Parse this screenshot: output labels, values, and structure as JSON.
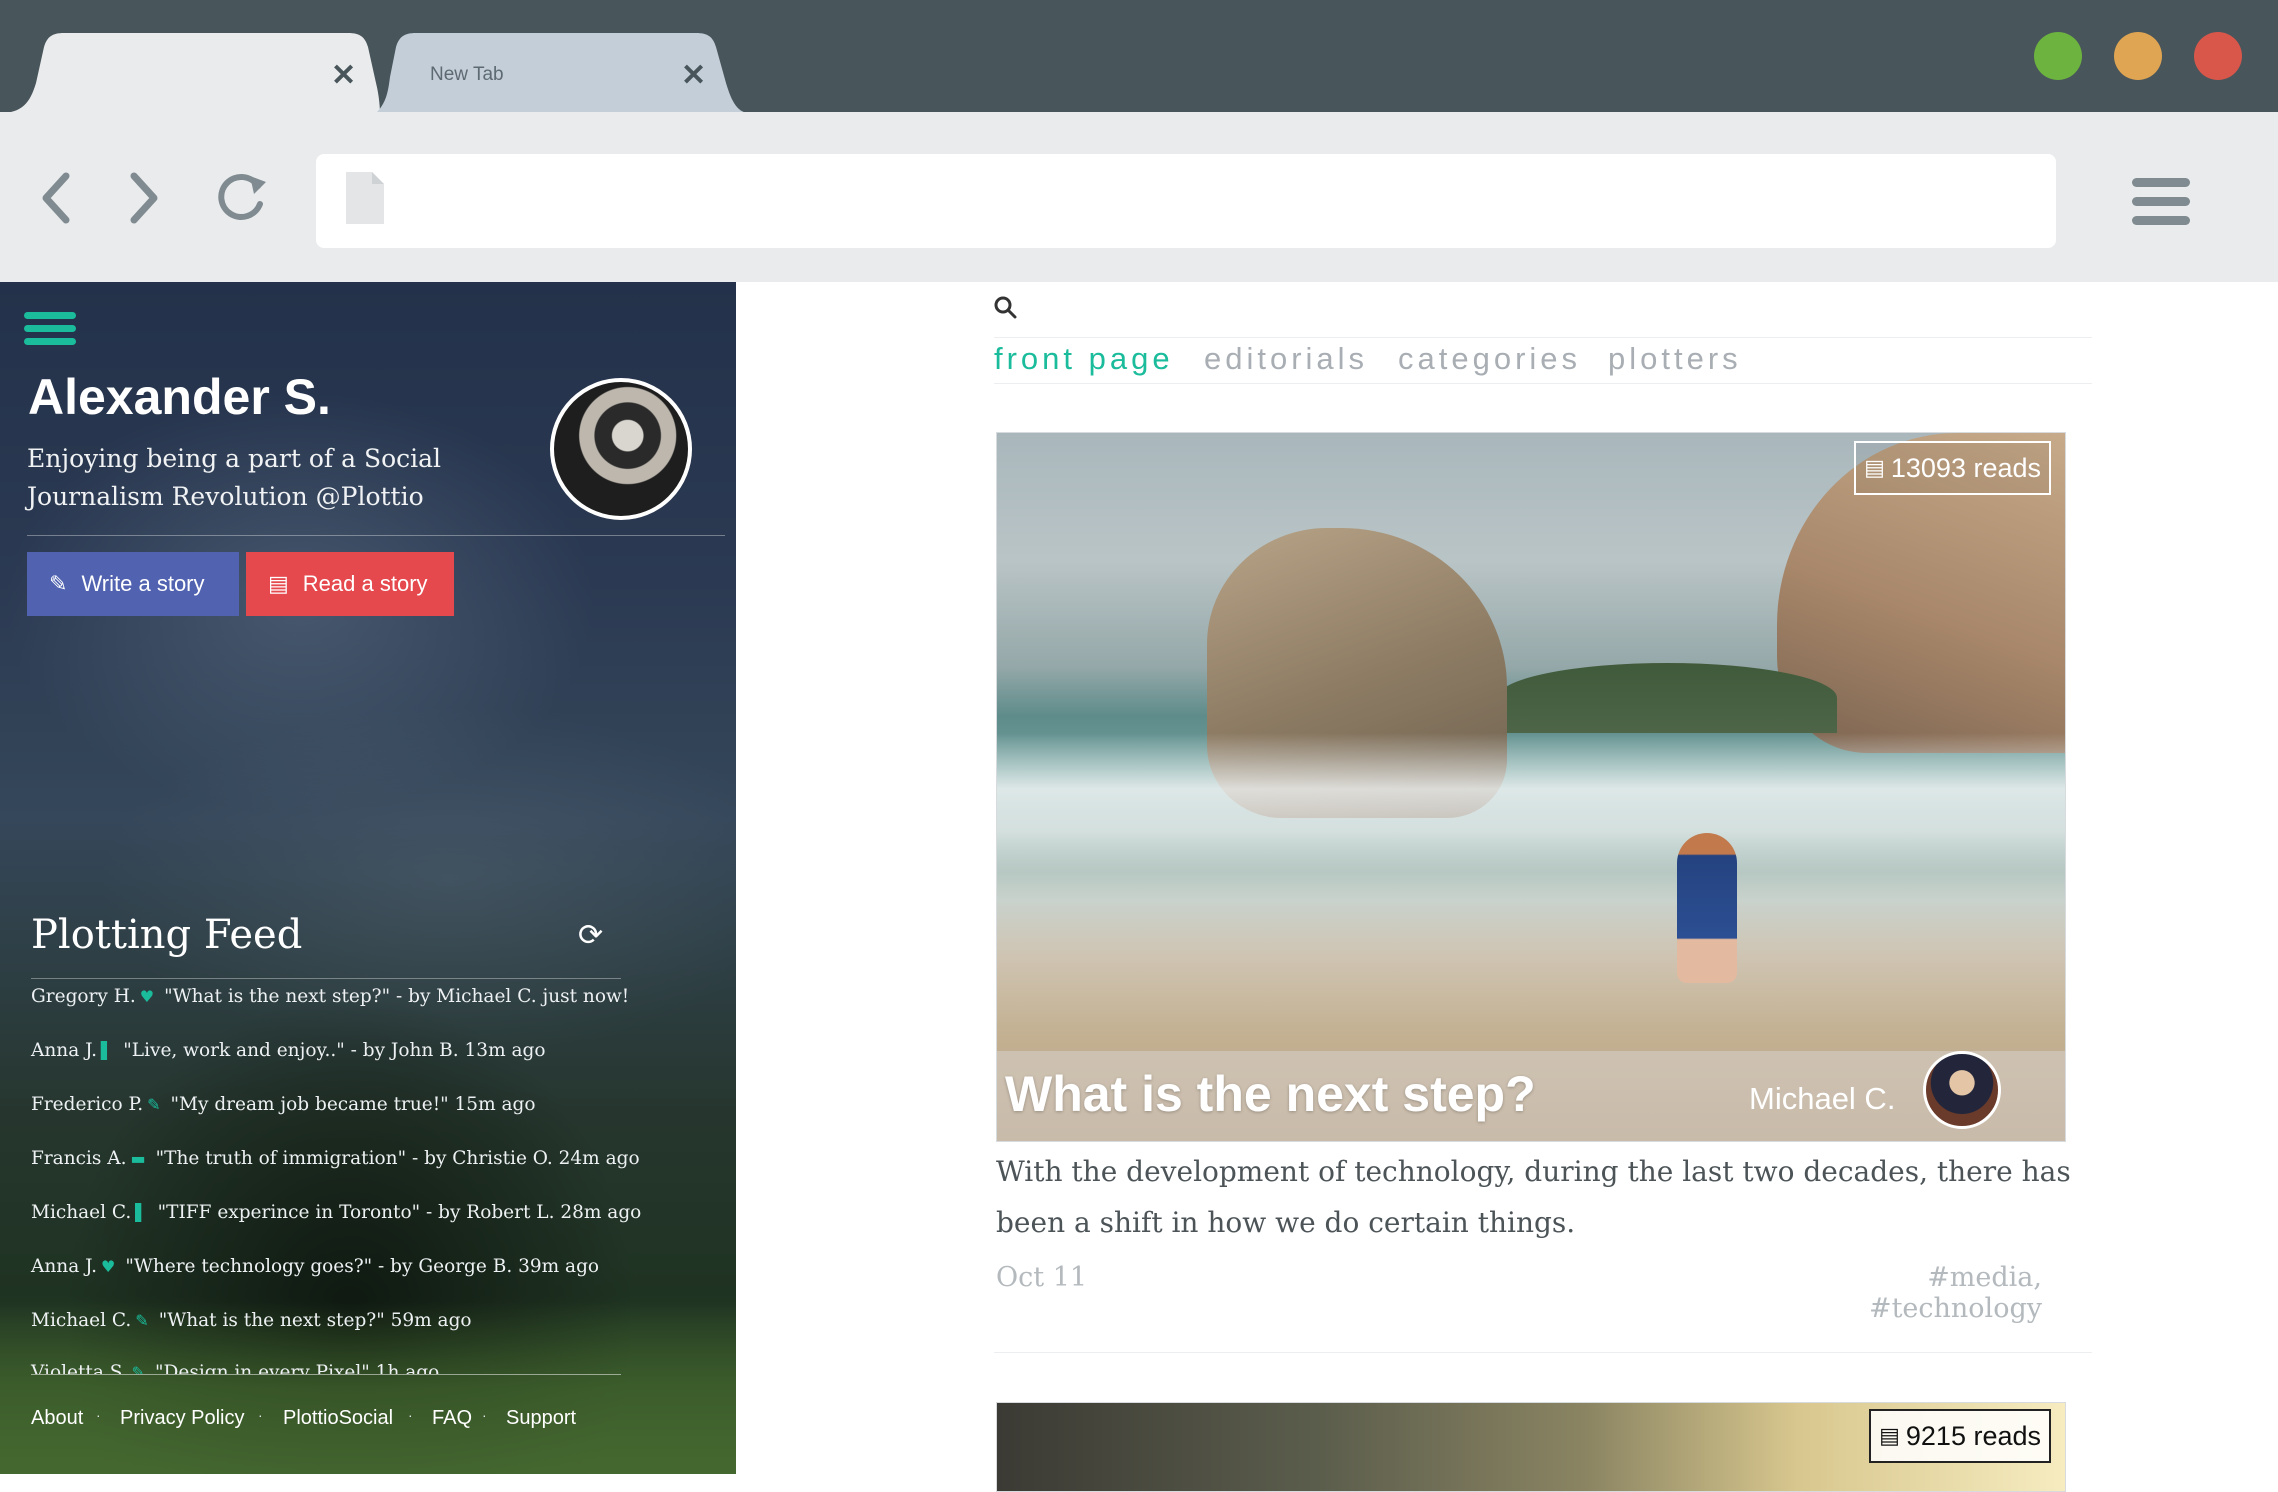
{
  "browser": {
    "tabs": [
      {
        "title": "",
        "close_icon": "✕"
      },
      {
        "title": "New Tab",
        "close_icon": "✕"
      }
    ],
    "traffic_lights": {
      "green": "#6db33f",
      "yellow": "#e0a552",
      "red": "#d9574a"
    },
    "omnibox": {
      "value": "",
      "icon": "document-icon"
    }
  },
  "sidebar": {
    "profile": {
      "name": "Alexander S.",
      "bio": "Enjoying being a part of a Social Journalism Revolution @Plottio"
    },
    "buttons": {
      "write": {
        "label": "Write a story",
        "icon": "quill-icon",
        "color": "#5062b0"
      },
      "read": {
        "label": "Read a story",
        "icon": "document-icon",
        "color": "#e5484d"
      }
    },
    "feed": {
      "title": "Plotting Feed",
      "items": [
        {
          "user": "Gregory H.",
          "mark": "♥",
          "text": "\"What is the next step?\" - by Michael C. just now!"
        },
        {
          "user": "Anna J.",
          "mark": "▌",
          "text": "\"Live, work and enjoy..\" - by John B. 13m ago"
        },
        {
          "user": "Frederico P.",
          "mark": "✎",
          "text": "\"My dream job became true!\" 15m ago"
        },
        {
          "user": "Francis A.",
          "mark": "▬",
          "text": "\"The truth of immigration\" - by Christie O. 24m ago"
        },
        {
          "user": "Michael C.",
          "mark": "▌",
          "text": "\"TIFF experince in Toronto\" - by Robert L. 28m ago"
        },
        {
          "user": "Anna J.",
          "mark": "♥",
          "text": "\"Where technology goes?\" - by George B. 39m ago"
        },
        {
          "user": "Michael C.",
          "mark": "✎",
          "text": "\"What is the next step?\" 59m ago"
        },
        {
          "user": "Violetta S.",
          "mark": "✎",
          "text": "\"Design in every Pixel\" 1h ago"
        }
      ]
    },
    "footer": [
      "About",
      "Privacy Policy",
      "PlottioSocial",
      "FAQ",
      "Support"
    ],
    "accent": "#1abc9c"
  },
  "main": {
    "nav": [
      "front page",
      "editorials",
      "categories",
      "plotters"
    ],
    "active_nav": "front page",
    "posts": [
      {
        "reads": "13093 reads",
        "title": "What is the next step?",
        "author": "Michael C.",
        "excerpt": "With the development of technology, during the last two decades, there has been a shift in how we do certain things.",
        "date": "Oct 11",
        "tags": "#media, #technology"
      },
      {
        "reads": "9215 reads"
      }
    ]
  }
}
